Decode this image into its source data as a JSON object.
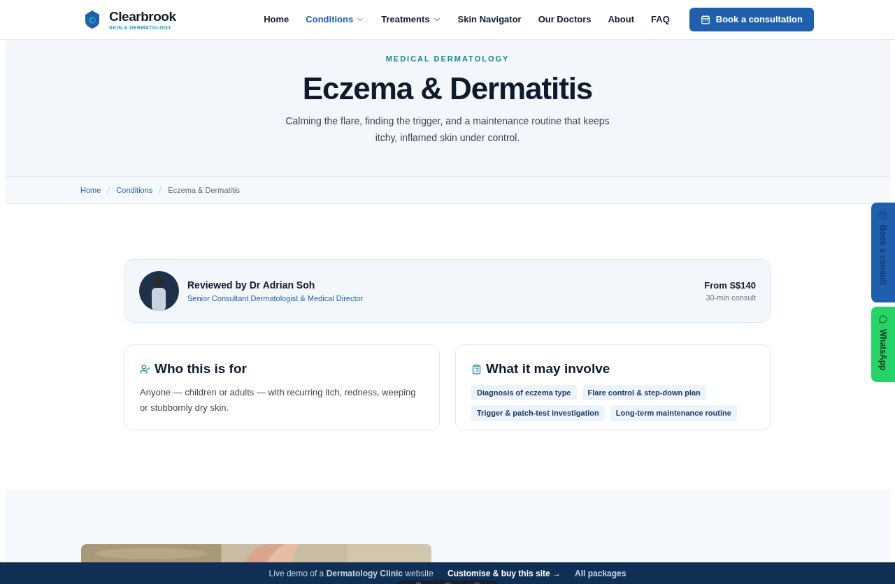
{
  "brand": {
    "name": "Clearbrook",
    "tagline": "SKIN & DERMATOLOGY"
  },
  "nav": [
    {
      "label": "Home",
      "selected": false,
      "dropdown": false
    },
    {
      "label": "Conditions",
      "selected": true,
      "dropdown": true
    },
    {
      "label": "Treatments",
      "selected": false,
      "dropdown": true
    },
    {
      "label": "Skin Navigator",
      "selected": false,
      "dropdown": false
    },
    {
      "label": "Our Doctors",
      "selected": false,
      "dropdown": false
    },
    {
      "label": "About",
      "selected": false,
      "dropdown": false
    },
    {
      "label": "FAQ",
      "selected": false,
      "dropdown": false
    }
  ],
  "cta": "Book a consultation",
  "hero": {
    "eyebrow": "MEDICAL DERMATOLOGY",
    "title": "Eczema & Dermatitis",
    "subtitle": "Calming the flare, finding the trigger, and a maintenance routine that keeps itchy, inflamed skin under control."
  },
  "breadcrumb": [
    {
      "label": "Home",
      "current": false
    },
    {
      "label": "Conditions",
      "current": false
    },
    {
      "label": "Eczema & Dermatitis",
      "current": true
    }
  ],
  "reviewer": {
    "name": "Reviewed by Dr Adrian Soh",
    "role": "Senior Consultant Dermatologist & Medical Director",
    "price": "From S$140",
    "duration": "30-min consult"
  },
  "who": {
    "title": "Who this is for",
    "text": "Anyone — children or adults — with recurring itch, redness, weeping or stubbornly dry skin."
  },
  "involve": {
    "title": "What it may involve",
    "tags": [
      "Diagnosis of eczema type",
      "Flare control & step-down plan",
      "Trigger & patch-test investigation",
      "Long-term maintenance routine"
    ]
  },
  "side_tabs": [
    {
      "kind": "consult",
      "label": "Book a consult"
    },
    {
      "kind": "whatsapp",
      "label": "WhatsApp"
    }
  ],
  "demo_bar": {
    "text": "Live demo of a **Dermatology Clinic** website",
    "buy": "Customise & buy this site →",
    "packages": "All packages"
  }
}
